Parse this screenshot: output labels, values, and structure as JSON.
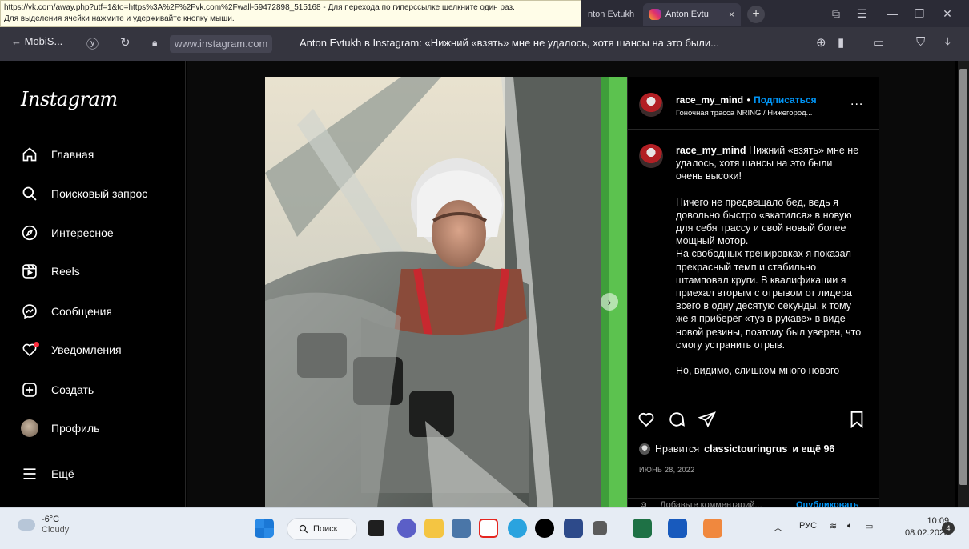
{
  "status_bar": {
    "line1": "https://vk.com/away.php?utf=1&to=https%3A%2F%2Fvk.com%2Fwall-59472898_515168 - Для перехода по гиперссылке щелкните один раз.",
    "line2": "Для выделения ячейки нажмите и удерживайте кнопку мыши."
  },
  "tabs": [
    {
      "label": "nton Evtukh",
      "active": false
    },
    {
      "label": "Anton Evtu",
      "active": true,
      "close": "×"
    }
  ],
  "address_bar": {
    "back_label": "← MobiS...",
    "url": "www.instagram.com",
    "page_title": "Anton Evtukh в Instagram: «Нижний «взять» мне не удалось, хотя шансы на это были..."
  },
  "sidebar": {
    "logo": "Instagram",
    "items": [
      {
        "label": "Главная",
        "icon": "home-icon"
      },
      {
        "label": "Поисковый запрос",
        "icon": "search-icon"
      },
      {
        "label": "Интересное",
        "icon": "compass-icon"
      },
      {
        "label": "Reels",
        "icon": "reels-icon"
      },
      {
        "label": "Сообщения",
        "icon": "messenger-icon"
      },
      {
        "label": "Уведомления",
        "icon": "heart-icon"
      },
      {
        "label": "Создать",
        "icon": "plus-square-icon"
      },
      {
        "label": "Профиль",
        "icon": "avatar"
      },
      {
        "label": "Ещё",
        "icon": "menu-icon"
      }
    ]
  },
  "post": {
    "username": "race_my_mind",
    "separator": "•",
    "follow_label": "Подписаться",
    "location": "Гоночная трасса NRING / Нижегород...",
    "more_label": "...",
    "caption_p1": "Нижний «взять» мне не удалось, хотя шансы на это были очень высоки!",
    "caption_p2": "Ничего не предвещало бед, ведь я довольно быстро «вкатился» в новую для себя трассу и свой новый более мощный мотор.\nНа свободных тренировках я показал прекрасный темп и стабильно штамповал круги. В квалификации я приехал вторым с отрывом от лидера всего в одну десятую секунды, к тому же я приберёг «туз в рукаве» в виде новой резины, поэтому был уверен, что смогу устранить отрыв.",
    "caption_p3": "Но, видимо, слишком много нового",
    "likes_prefix": "Нравится",
    "likes_user": "classictouringrus",
    "likes_suffix": "и ещё 96",
    "date": "ИЮНЬ 28, 2022",
    "comment_placeholder": "Добавьте комментарий...",
    "publish_label": "Опубликовать",
    "next_label": "›"
  },
  "taskbar": {
    "temp": "-6°C",
    "condition": "Cloudy",
    "search_label": "Поиск",
    "lang": "РУС",
    "time": "10:09",
    "date": "08.02.2023",
    "notif_count": "4"
  },
  "colors": {
    "instagram_blue": "#0095f6",
    "notification_red": "#ff3040"
  }
}
